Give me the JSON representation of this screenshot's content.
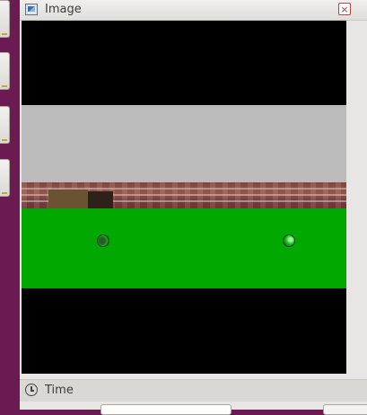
{
  "window": {
    "title": "Image",
    "close_glyph": "×"
  },
  "time_panel": {
    "label": "Time"
  },
  "icons": {
    "app": "image-viewer-icon",
    "time": "clock-icon"
  },
  "colors": {
    "desktop": "#6b1a52",
    "ground": "#00a800",
    "sky": "#bcbcbc"
  }
}
